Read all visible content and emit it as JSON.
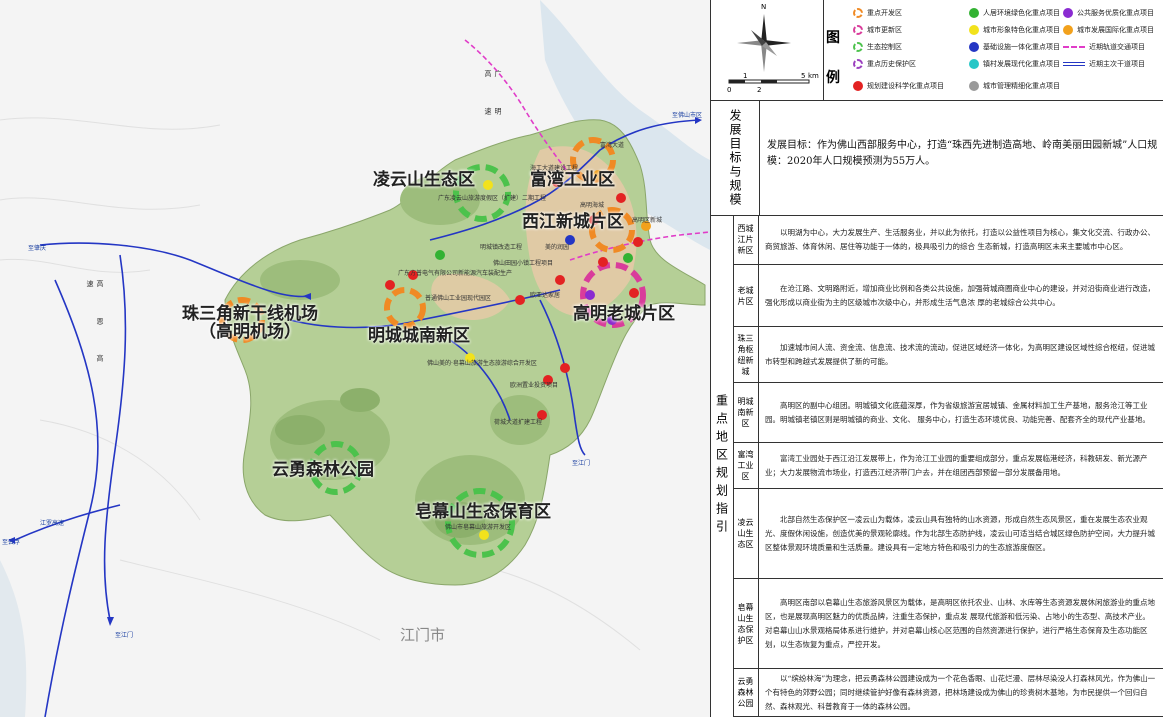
{
  "map": {
    "zones": [
      {
        "label": "凌云山生态区"
      },
      {
        "label": "富湾工业区"
      },
      {
        "label": "西江新城片区"
      },
      {
        "label": "珠三角新干线机场\n（高明机场）"
      },
      {
        "label": "明城城南新区"
      },
      {
        "label": "高明老城片区"
      },
      {
        "label": "云勇森林公园"
      },
      {
        "label": "皂幕山生态保育区"
      }
    ],
    "project_labels": [
      "广东凌云山旅游度假区（扩建）二期工程",
      "明城镇改造工程",
      "广东方普电气有限公司新能源汽车装配生产",
      "佛山田园小镇工程项目",
      "普通佛山工业园现代园区",
      "欧亚达家居",
      "佛山美的·皂幕山旅游生态旅游综合开发区",
      "欧洲置业投资项目",
      "荷城大道扩建工程",
      "佛山市皂幕山旅游开发区",
      "高明海城",
      "美的润园",
      "富湾大道",
      "高明区新城",
      "海工大道建设工程"
    ],
    "road_labels": [
      "至肇庆",
      "至佛山市区",
      "至江门",
      "至江门",
      "至云浮",
      "江罗高速"
    ],
    "vertical_road": "广 明 高 速",
    "vertical_road2": "高 恩 高 速",
    "city_label": "江门市",
    "compass": {
      "north": "N",
      "scale_labels": [
        "0",
        "1",
        "2",
        "5",
        "km"
      ]
    }
  },
  "legend": {
    "title": [
      "图",
      "例"
    ],
    "items": [
      {
        "label": "重点开发区",
        "type": "dashed-circle",
        "color": "#f08a24"
      },
      {
        "label": "城市更新区",
        "type": "dashed-circle",
        "color": "#d93c9b"
      },
      {
        "label": "生态控制区",
        "type": "dashed-circle",
        "color": "#4cc24c"
      },
      {
        "label": "重点历史保护区",
        "type": "dashed-circle",
        "color": "#9b3fbf"
      },
      {
        "label": "规划建设科学化重点项目",
        "type": "dot",
        "color": "#e32222"
      },
      {
        "label": "人居环境绿色化重点项目",
        "type": "dot",
        "color": "#33b233"
      },
      {
        "label": "城市形象特色化重点项目",
        "type": "dot",
        "color": "#f2e21c"
      },
      {
        "label": "基础设施一体化重点项目",
        "type": "dot",
        "color": "#2436c4"
      },
      {
        "label": "镇村发展现代化重点项目",
        "type": "dot",
        "color": "#27c7c7"
      },
      {
        "label": "城市管理精细化重点项目",
        "type": "dot",
        "color": "#9a9a9a"
      },
      {
        "label": "公共服务优质化重点项目",
        "type": "dot",
        "color": "#8a2bd1"
      },
      {
        "label": "城市发展国际化重点项目",
        "type": "dot",
        "color": "#f2a11c"
      },
      {
        "label": "近期轨道交通项目",
        "type": "dash-line",
        "color": "#e03cc8"
      },
      {
        "label": "近期主次干道项目",
        "type": "double-line",
        "color": "#2436c4"
      }
    ]
  },
  "goal": {
    "heading": "发展目标与规模",
    "text": "发展目标：作为佛山西部服务中心，打造“珠西先进制造高地、岭南美丽田园新城”人口规模：2020年人口规模预测为55万人。"
  },
  "guidance": {
    "heading": "重点地区规划指引",
    "rows": [
      {
        "name": "西城江片新区",
        "text": "以明湖为中心，大力发展生产、生活服务业，并以此为依托，打造以公益性项目为核心，集文化交流、行政办公、商贸旅游、体育休闲、居住等功能于一体的，极具吸引力的综合 生态新城，打造高明区未来主要城市中心区。"
      },
      {
        "name": "老城片区",
        "text": "在沧江路、文明路附近，增加商业比例和各类公共设施，加强荷城商圈商业中心的建设，并对沿街商业进行改造，强化形成以商业街为主的区级城市次级中心，并形成生活气息浓 厚的老城综合公共中心。"
      },
      {
        "name": "珠三角枢纽新城",
        "text": "加速城市间人流、资金流、信息流、技术流的流动，促进区域经济一体化，为高明区建设区域性综合枢纽，促进城市转型和跨越式发展提供了新的可能。"
      },
      {
        "name": "明城南新区",
        "text": "高明区的副中心组团。明城镇文化底蕴深厚，作为省级旅游宜居城镇、金属材料加工生产基地，服务沧江等工业园。明城镇老镇区则是明城镇的商业、文化、 服务中心，打造生态环境优良、功能完善、配套齐全的现代产业基地。"
      },
      {
        "name": "富湾工业区",
        "text": "富湾工业园处于西江沿江发展带上，作为沧江工业园的重要组成部分，重点发展临港经济，科教研发、新光源产业；大力发展物流市场业，打造西江经济带门户去，并在组团西部预留一部分发展备用地。"
      },
      {
        "name": "凌云山生态区",
        "text": "北部自然生态保护区一凌云山为载体，凌云山具有独特的山水资源，形成自然生态风景区，重在发展生态农业观光、度假休闲设施，创造优美的景观轮廓线。作为北部生态防护线，凌云山可适当结合城区绿色防护空间，大力提升城区整体景观环境质量和生活质量。建设具有一定地方特色和吸引力的生态旅游度假区。"
      },
      {
        "name": "皂幕山生态保护区",
        "text": "高明区南部以皂幕山生态旅游风景区为载体，是高明区依托农业、山林、水库等生态资源发展休闲旅游业的重点地区，也是展现高明区魅力的优质品牌，注重生态保护，重点发 展现代旅游和低污染、占地小的生态型、高技术产业。 对皂幕山山水景观格局体系进行维护，并对皂幕山核心区范围的自然资源进行保护，进行严格生态保育及生态功能区划，以生态恢复为重点，严控开发。"
      },
      {
        "name": "云勇森林公园",
        "text": "以“缤纷林海”为理念，把云勇森林公园建设成为一个花色香眼、山花烂漫、层林尽染没人打森林风光，作为佛山一个有特色的郊野公园；同时继续管护好像有森林资源，把林场建设成为佛山的珍贵树木基地，为市民提供一个回归自然、森林观光、科普教育于一体的森林公园。"
      }
    ]
  }
}
